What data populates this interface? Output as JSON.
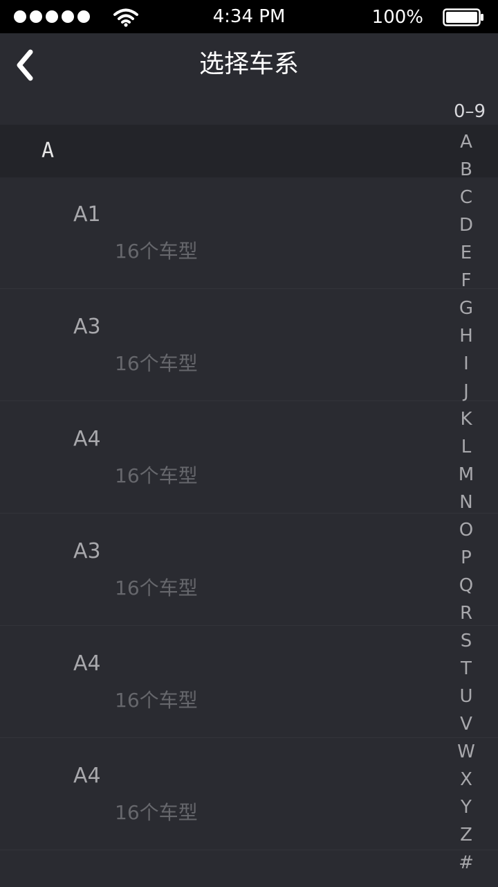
{
  "status_bar": {
    "time": "4:34 PM",
    "battery": "100%",
    "signal_dots": 5,
    "icons": [
      "signal-dots-icon",
      "wifi-icon",
      "battery-icon"
    ]
  },
  "nav": {
    "title": "选择车系",
    "back_icon": "chevron-left-icon"
  },
  "section": {
    "letter": "A"
  },
  "items": [
    {
      "name": "A1",
      "count": "16个车型"
    },
    {
      "name": "A3",
      "count": "16个车型"
    },
    {
      "name": "A4",
      "count": "16个车型"
    },
    {
      "name": "A3",
      "count": "16个车型"
    },
    {
      "name": "A4",
      "count": "16个车型"
    },
    {
      "name": "A4",
      "count": "16个车型"
    }
  ],
  "index": {
    "top": "0–9",
    "letters": [
      "A",
      "B",
      "C",
      "D",
      "E",
      "F",
      "G",
      "H",
      "I",
      "J",
      "K",
      "L",
      "M",
      "N",
      "O",
      "P",
      "Q",
      "R",
      "S",
      "T",
      "U",
      "V",
      "W",
      "X",
      "Y",
      "Z",
      "#"
    ]
  },
  "colors": {
    "background": "#2a2b31",
    "section_header": "#232429",
    "status_bar": "#000000",
    "primary_text": "#ffffff",
    "secondary_text": "#a8a8ac",
    "muted_text": "#66676c"
  }
}
